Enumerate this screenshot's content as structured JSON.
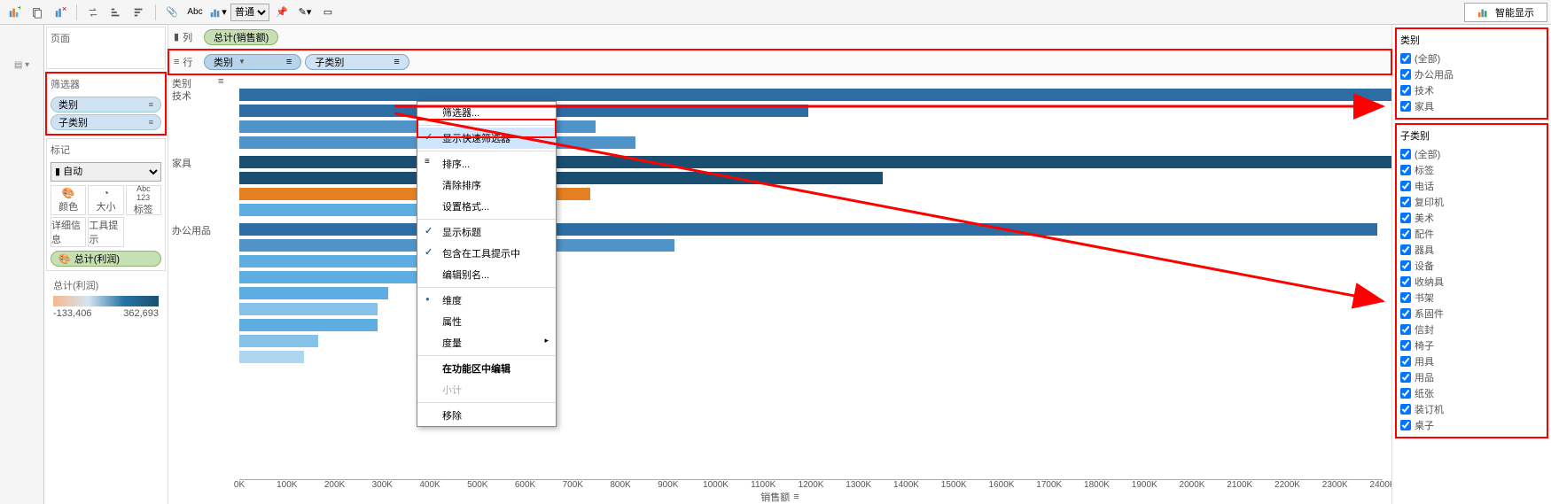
{
  "toolbar": {
    "style_select": "普通",
    "showme_label": "智能显示"
  },
  "pages_card": {
    "title": "页面"
  },
  "filters_card": {
    "title": "筛选器",
    "items": [
      {
        "label": "类别"
      },
      {
        "label": "子类别"
      }
    ]
  },
  "marks_card": {
    "title": "标记",
    "select_value": "自动",
    "cells": [
      {
        "label": "颜色"
      },
      {
        "label": "大小"
      },
      {
        "label": "标签"
      },
      {
        "label": "详细信息"
      },
      {
        "label": "工具提示"
      }
    ],
    "color_pill": "总计(利润)"
  },
  "legend": {
    "title": "总计(利润)",
    "min": "-133,406",
    "max": "362,693"
  },
  "shelves": {
    "columns_label": "列",
    "rows_label": "行",
    "column_pill": "总计(销售额)",
    "row_pills": [
      {
        "label": "类别"
      },
      {
        "label": "子类别"
      }
    ]
  },
  "context_menu": {
    "items": [
      {
        "label": "筛选器...",
        "type": "plain"
      },
      {
        "label": "显示快速筛选器",
        "type": "checked_sel"
      },
      {
        "label": "排序...",
        "type": "icon",
        "ic": "≡"
      },
      {
        "label": "清除排序",
        "type": "plain"
      },
      {
        "label": "设置格式...",
        "type": "plain"
      },
      {
        "label": "显示标题",
        "type": "checked"
      },
      {
        "label": "包含在工具提示中",
        "type": "checked"
      },
      {
        "label": "编辑别名...",
        "type": "plain"
      },
      {
        "label": "维度",
        "type": "dot"
      },
      {
        "label": "属性",
        "type": "plain"
      },
      {
        "label": "度量",
        "type": "sub"
      },
      {
        "label": "在功能区中编辑",
        "type": "bold"
      },
      {
        "label": "小计",
        "type": "disabled"
      },
      {
        "label": "移除",
        "type": "plain"
      }
    ]
  },
  "chart_data": {
    "type": "bar",
    "xlabel": "销售额",
    "header_cat": "类别",
    "header_sort_icon": "sort",
    "xlim": [
      0,
      2400000
    ],
    "xticks": [
      "0K",
      "100K",
      "200K",
      "300K",
      "400K",
      "500K",
      "600K",
      "700K",
      "800K",
      "900K",
      "1000K",
      "1100K",
      "1200K",
      "1300K",
      "1400K",
      "1500K",
      "1600K",
      "1700K",
      "1800K",
      "1900K",
      "2000K",
      "2100K",
      "2200K",
      "2300K",
      "2400K"
    ],
    "groups": [
      {
        "category": "技术",
        "bars": [
          {
            "value": 2400000,
            "color": "#2e6da4"
          },
          {
            "value": 1150000,
            "color": "#2e6da4"
          },
          {
            "value": 720000,
            "color": "#4f93c9"
          },
          {
            "value": 800000,
            "color": "#4f93c9"
          }
        ]
      },
      {
        "category": "家具",
        "bars": [
          {
            "value": 2350000,
            "color": "#1b4f72"
          },
          {
            "value": 1300000,
            "color": "#1b4f72"
          },
          {
            "value": 710000,
            "color": "#e67e22"
          },
          {
            "value": 560000,
            "color": "#5dade2"
          }
        ]
      },
      {
        "category": "办公用品",
        "bars": [
          {
            "value": 2300000,
            "color": "#2e6da4"
          },
          {
            "value": 880000,
            "color": "#4f93c9"
          },
          {
            "value": 480000,
            "color": "#5dade2"
          },
          {
            "value": 360000,
            "color": "#5dade2"
          },
          {
            "value": 300000,
            "color": "#5dade2"
          },
          {
            "value": 280000,
            "color": "#85c1e9"
          },
          {
            "value": 280000,
            "color": "#5dade2"
          },
          {
            "value": 160000,
            "color": "#85c1e9"
          },
          {
            "value": 130000,
            "color": "#aed6f1"
          }
        ]
      }
    ]
  },
  "right_filters": [
    {
      "title": "类别",
      "options": [
        "(全部)",
        "办公用品",
        "技术",
        "家具"
      ]
    },
    {
      "title": "子类别",
      "options": [
        "(全部)",
        "标签",
        "电话",
        "复印机",
        "美术",
        "配件",
        "器具",
        "设备",
        "收纳具",
        "书架",
        "系固件",
        "信封",
        "椅子",
        "用具",
        "用品",
        "纸张",
        "装订机",
        "桌子"
      ]
    }
  ]
}
